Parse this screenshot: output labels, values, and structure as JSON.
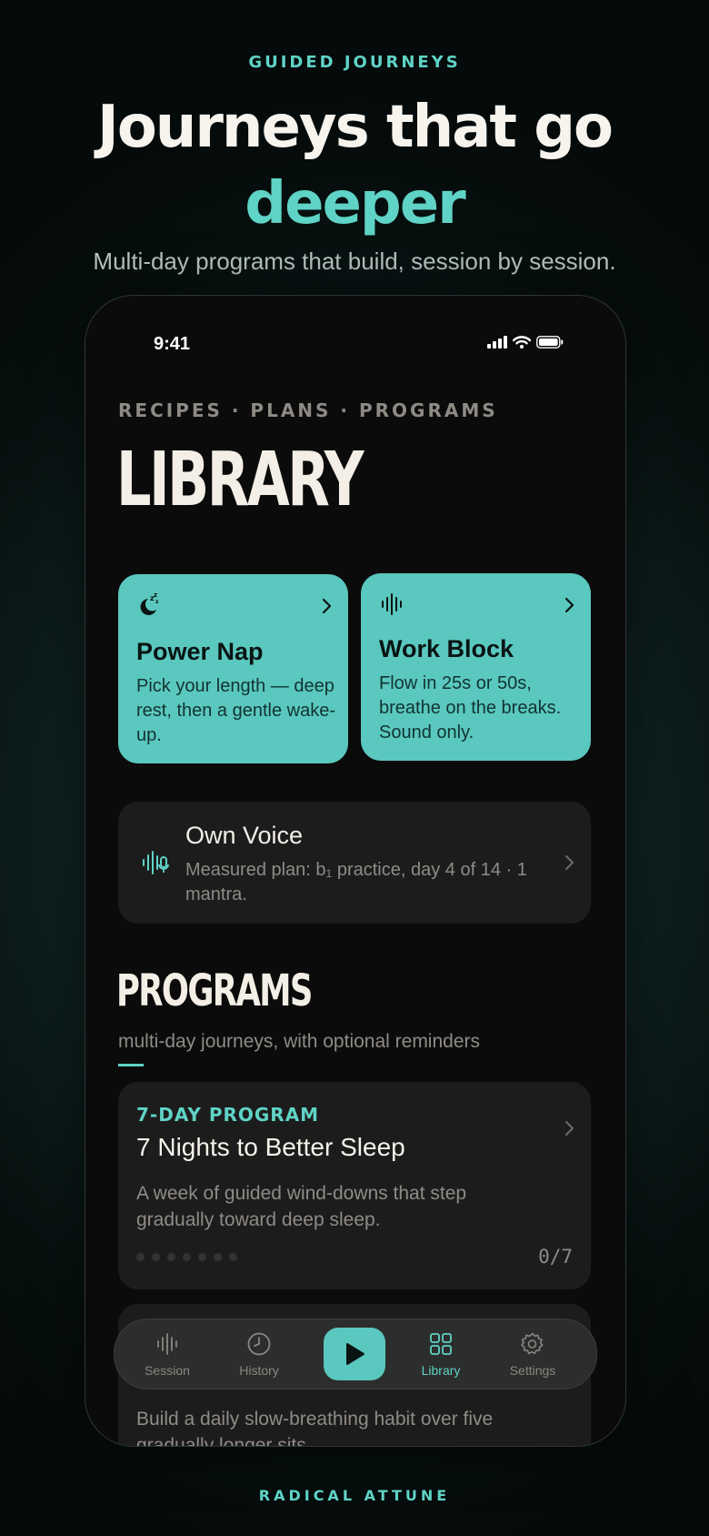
{
  "hero": {
    "kicker": "GUIDED JOURNEYS",
    "headline_line1": "Journeys that go",
    "headline_accent": "deeper",
    "subhead": "Multi-day programs that build, session by session."
  },
  "statusbar": {
    "time": "9:41"
  },
  "library": {
    "eyebrow": "RECIPES · PLANS · PROGRAMS",
    "title": "LIBRARY",
    "tiles": [
      {
        "title": "Power Nap",
        "description": "Pick your length — deep rest, then a gentle wake-up.",
        "icon": "moon-sleep-icon"
      },
      {
        "title": "Work Block",
        "description": "Flow in 25s or 50s, breathe on the breaks. Sound only.",
        "icon": "waveform-icon"
      }
    ],
    "voice_card": {
      "title": "Own Voice",
      "description": "Measured plan: b₁ practice, day 4 of 14 · 1 mantra.",
      "icon": "voice-mic-icon"
    }
  },
  "programs": {
    "title": "PROGRAMS",
    "subtitle": "multi-day journeys, with optional reminders",
    "items": [
      {
        "tag": "7-DAY PROGRAM",
        "title": "7 Nights to Better Sleep",
        "description": "A week of guided wind-downs that step gradually toward deep sleep.",
        "progress": "0/7",
        "days_total": 7,
        "days_done": 0
      },
      {
        "description": "Build a daily slow-breathing habit over five gradually longer sits."
      }
    ]
  },
  "tabbar": {
    "tabs": [
      {
        "label": "Session",
        "icon": "waveform-icon"
      },
      {
        "label": "History",
        "icon": "clock-icon"
      },
      {
        "label": "",
        "icon": "play-icon"
      },
      {
        "label": "Library",
        "icon": "grid-icon",
        "active": true
      },
      {
        "label": "Settings",
        "icon": "gear-icon"
      }
    ]
  },
  "brand": "RADICAL ATTUNE",
  "colors": {
    "accent": "#5fd3c6",
    "tile": "#5ac8be",
    "card": "#1c1c1c",
    "screen": "#0b0b0b"
  }
}
